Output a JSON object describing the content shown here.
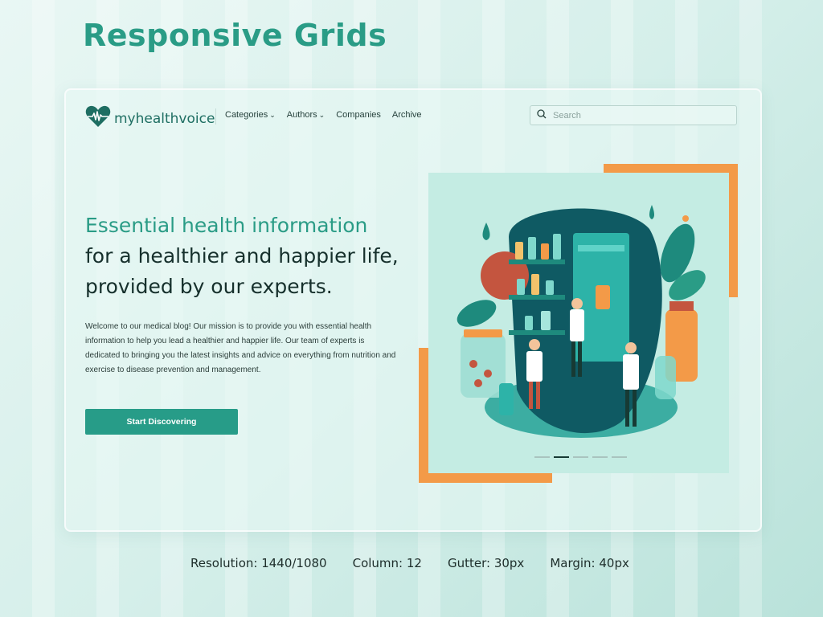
{
  "page_title": "Responsive Grids",
  "brand": {
    "name": "myhealthvoice",
    "color": "#1e6e62",
    "accent": "#2a9c86"
  },
  "nav": [
    {
      "label": "Categories",
      "has_dropdown": true
    },
    {
      "label": "Authors",
      "has_dropdown": true
    },
    {
      "label": "Companies",
      "has_dropdown": false
    },
    {
      "label": "Archive",
      "has_dropdown": false
    }
  ],
  "search": {
    "placeholder": "Search",
    "value": ""
  },
  "hero": {
    "title_accent": "Essential health information",
    "title_rest": "for a healthier and happier life, provided by our experts.",
    "description": "Welcome to our medical blog! Our mission is to provide you with essential health information to help you lead a healthier and happier life. Our team of experts is dedicated to bringing you the latest insights and advice on everything from nutrition and exercise to disease prevention and management.",
    "cta_label": "Start Discovering"
  },
  "carousel": {
    "slide_count": 5,
    "active_index": 1
  },
  "specs": {
    "resolution": "Resolution: 1440/1080",
    "column": "Column: 12",
    "gutter": "Gutter: 30px",
    "margin": "Margin: 40px"
  },
  "colors": {
    "primary": "#279c88",
    "orange": "#f39a48",
    "dark_teal": "#0f5a63",
    "text": "#16302c"
  },
  "icons": [
    "heart-pulse-logo-icon",
    "chevron-down-icon",
    "search-icon"
  ]
}
